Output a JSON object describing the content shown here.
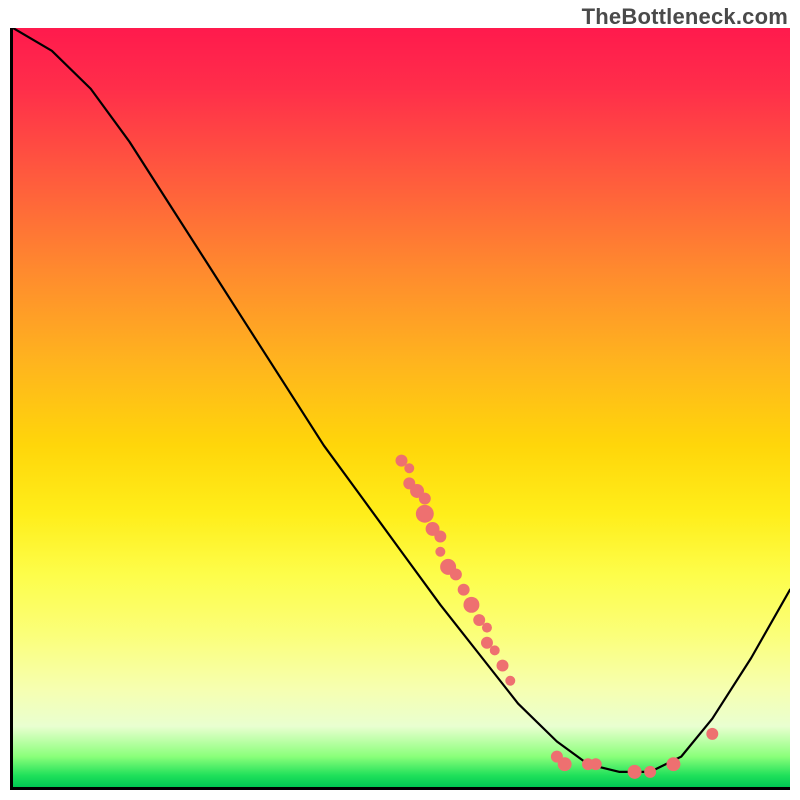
{
  "watermark": "TheBottleneck.com",
  "chart_data": {
    "type": "line",
    "title": "",
    "xlabel": "",
    "ylabel": "",
    "xlim": [
      0,
      100
    ],
    "ylim": [
      0,
      100
    ],
    "curve": [
      {
        "x": 0,
        "y": 100
      },
      {
        "x": 5,
        "y": 97
      },
      {
        "x": 10,
        "y": 92
      },
      {
        "x": 15,
        "y": 85
      },
      {
        "x": 20,
        "y": 77
      },
      {
        "x": 25,
        "y": 69
      },
      {
        "x": 30,
        "y": 61
      },
      {
        "x": 35,
        "y": 53
      },
      {
        "x": 40,
        "y": 45
      },
      {
        "x": 45,
        "y": 38
      },
      {
        "x": 50,
        "y": 31
      },
      {
        "x": 55,
        "y": 24
      },
      {
        "x": 60,
        "y": 17.5
      },
      {
        "x": 65,
        "y": 11
      },
      {
        "x": 70,
        "y": 6
      },
      {
        "x": 74,
        "y": 3
      },
      {
        "x": 78,
        "y": 2
      },
      {
        "x": 82,
        "y": 2
      },
      {
        "x": 86,
        "y": 4
      },
      {
        "x": 90,
        "y": 9
      },
      {
        "x": 95,
        "y": 17
      },
      {
        "x": 100,
        "y": 26
      }
    ],
    "scatter_points": [
      {
        "x": 50,
        "y": 43,
        "r": 6
      },
      {
        "x": 51,
        "y": 42,
        "r": 5
      },
      {
        "x": 51,
        "y": 40,
        "r": 6
      },
      {
        "x": 52,
        "y": 39,
        "r": 7
      },
      {
        "x": 53,
        "y": 38,
        "r": 6
      },
      {
        "x": 53,
        "y": 36,
        "r": 9
      },
      {
        "x": 54,
        "y": 34,
        "r": 7
      },
      {
        "x": 55,
        "y": 33,
        "r": 6
      },
      {
        "x": 55,
        "y": 31,
        "r": 5
      },
      {
        "x": 56,
        "y": 29,
        "r": 8
      },
      {
        "x": 57,
        "y": 28,
        "r": 6
      },
      {
        "x": 58,
        "y": 26,
        "r": 6
      },
      {
        "x": 59,
        "y": 24,
        "r": 8
      },
      {
        "x": 60,
        "y": 22,
        "r": 6
      },
      {
        "x": 61,
        "y": 21,
        "r": 5
      },
      {
        "x": 61,
        "y": 19,
        "r": 6
      },
      {
        "x": 62,
        "y": 18,
        "r": 5
      },
      {
        "x": 63,
        "y": 16,
        "r": 6
      },
      {
        "x": 64,
        "y": 14,
        "r": 5
      },
      {
        "x": 70,
        "y": 4,
        "r": 6
      },
      {
        "x": 71,
        "y": 3,
        "r": 7
      },
      {
        "x": 74,
        "y": 3,
        "r": 6
      },
      {
        "x": 75,
        "y": 3,
        "r": 6
      },
      {
        "x": 80,
        "y": 2,
        "r": 7
      },
      {
        "x": 82,
        "y": 2,
        "r": 6
      },
      {
        "x": 85,
        "y": 3,
        "r": 7
      },
      {
        "x": 90,
        "y": 7,
        "r": 6
      }
    ]
  }
}
